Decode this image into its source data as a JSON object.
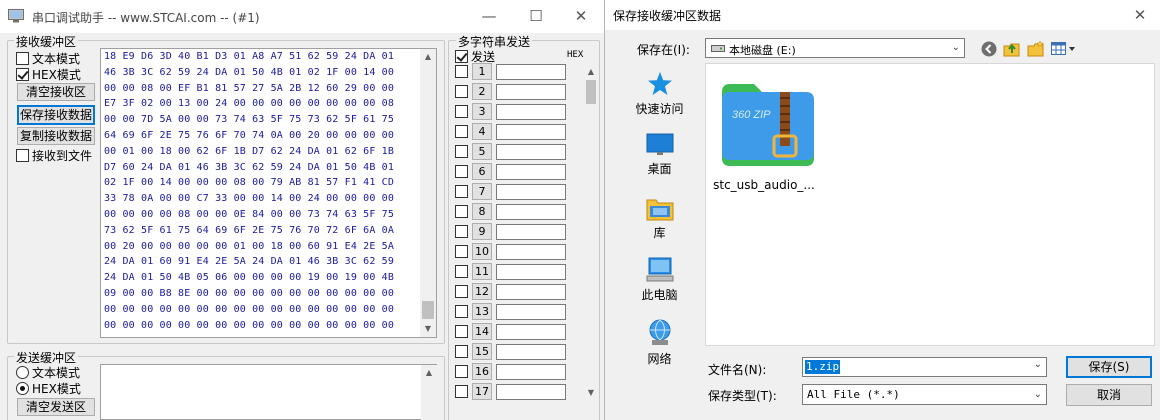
{
  "left_window": {
    "title": "串口调试助手 -- www.STCAI.com -- (#1)",
    "controls": {
      "minimize": "—",
      "maximize": "☐",
      "close": "✕"
    },
    "receive": {
      "group_label": "接收缓冲区",
      "text_mode": "文本模式",
      "hex_mode": "HEX模式",
      "hex_mode_checked": true,
      "text_mode_checked": false,
      "clear_button": "清空接收区",
      "save_button": "保存接收数据",
      "copy_button": "复制接收数据",
      "to_file": "接收到文件",
      "to_file_checked": false,
      "hex_lines": [
        "18 E9 D6 3D 40 B1 D3 01 A8 A7 51 62 59 24 DA 01",
        "46 3B 3C 62 59 24 DA 01 50 4B 01 02 1F 00 14 00",
        "00 00 08 00 EF B1 81 57 27 5A 2B 12 60 29 00 00",
        "E7 3F 02 00 13 00 24 00 00 00 00 00 00 00 00 08",
        "00 00 7D 5A 00 00 73 74 63 5F 75 73 62 5F 61 75",
        "64 69 6F 2E 75 76 6F 70 74 0A 00 20 00 00 00 00",
        "00 01 00 18 00 62 6F 1B D7 62 24 DA 01 62 6F 1B",
        "D7 60 24 DA 01 46 3B 3C 62 59 24 DA 01 50 4B 01",
        "02 1F 00 14 00 00 00 08 00 79 AB 81 57 F1 41 CD",
        "33 78 0A 00 00 C7 33 00 00 14 00 24 00 00 00 00",
        "00 00 00 00 08 00 00 0E 84 00 00 73 74 63 5F 75",
        "73 62 5F 61 75 64 69 6F 2E 75 76 70 72 6F 6A 0A",
        "00 20 00 00 00 00 00 01 00 18 00 60 91 E4 2E 5A",
        "24 DA 01 60 91 E4 2E 5A 24 DA 01 46 3B 3C 62 59",
        "24 DA 01 50 4B 05 06 00 00 00 00 19 00 19 00 4B",
        "09 00 00 B8 8E 00 00 00 00 00 00 00 00 00 00 00",
        "00 00 00 00 00 00 00 00 00 00 00 00 00 00 00 00",
        "00 00 00 00 00 00 00 00 00 00 00 00 00 00 00 00"
      ]
    },
    "send": {
      "group_label": "发送缓冲区",
      "text_mode": "文本模式",
      "hex_mode": "HEX模式",
      "text_mode_selected": false,
      "hex_mode_selected": true,
      "clear_button": "清空发送区"
    },
    "multi": {
      "group_label": "多字符串发送",
      "send_header": "发送",
      "hex_header": "HEX",
      "rows": [
        "1",
        "2",
        "3",
        "4",
        "5",
        "6",
        "7",
        "8",
        "9",
        "10",
        "11",
        "12",
        "13",
        "14",
        "15",
        "16",
        "17"
      ],
      "rows_checked": true
    }
  },
  "dialog": {
    "title": "保存接收缓冲区数据",
    "close": "✕",
    "save_in_label": "保存在(I):",
    "location": "本地磁盘 (E:)",
    "places": [
      {
        "label": "快速访问",
        "icon": "star-icon"
      },
      {
        "label": "桌面",
        "icon": "desktop-icon"
      },
      {
        "label": "库",
        "icon": "library-folder-icon"
      },
      {
        "label": "此电脑",
        "icon": "computer-icon"
      },
      {
        "label": "网络",
        "icon": "network-icon"
      }
    ],
    "file": {
      "name": "stc_usb_audio_...",
      "icon": "zip-archive-icon",
      "badge": "360 ZIP"
    },
    "filename_label": "文件名(N):",
    "filename_value": "1.zip",
    "filetype_label": "保存类型(T):",
    "filetype_value": "All File (*.*)",
    "save_button": "保存(S)",
    "cancel_button": "取消",
    "colors": {
      "accent": "#0078d7",
      "zip_blue": "#3d9be9",
      "zip_green": "#3cba54",
      "zip_brown": "#8b4a1a"
    }
  }
}
